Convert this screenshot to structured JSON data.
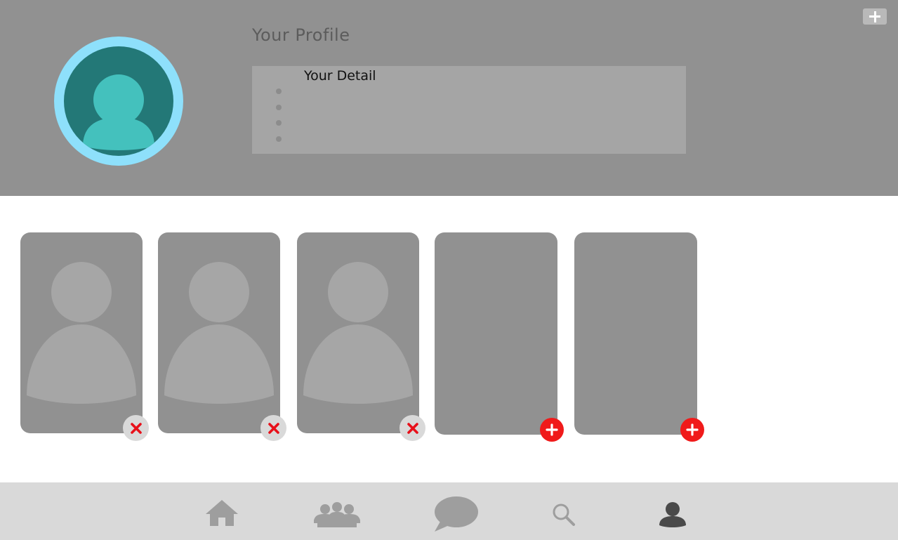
{
  "header": {
    "title": "Your Profile",
    "avatar_icon": "person-avatar-icon",
    "add_button_icon": "plus-icon"
  },
  "details": {
    "title": "Your Detail",
    "items": [
      "",
      "",
      "",
      ""
    ]
  },
  "photos": {
    "slots": [
      {
        "filled": true,
        "action": "remove"
      },
      {
        "filled": true,
        "action": "remove"
      },
      {
        "filled": true,
        "action": "remove"
      },
      {
        "filled": false,
        "action": "add"
      },
      {
        "filled": false,
        "action": "add"
      }
    ]
  },
  "nav": {
    "items": [
      {
        "icon": "home-icon",
        "active": false
      },
      {
        "icon": "people-icon",
        "active": false
      },
      {
        "icon": "chat-icon",
        "active": false
      },
      {
        "icon": "search-icon",
        "active": false
      },
      {
        "icon": "profile-icon",
        "active": true
      }
    ]
  },
  "colors": {
    "header_bg": "#919191",
    "avatar_ring": "#8ee0fb",
    "avatar_bg": "#237877",
    "avatar_figure": "#44c1bd",
    "add_badge": "#f01a1a",
    "remove_x": "#e8101a",
    "nav_inactive": "#9e9e9e",
    "nav_active": "#4a4a4a"
  }
}
